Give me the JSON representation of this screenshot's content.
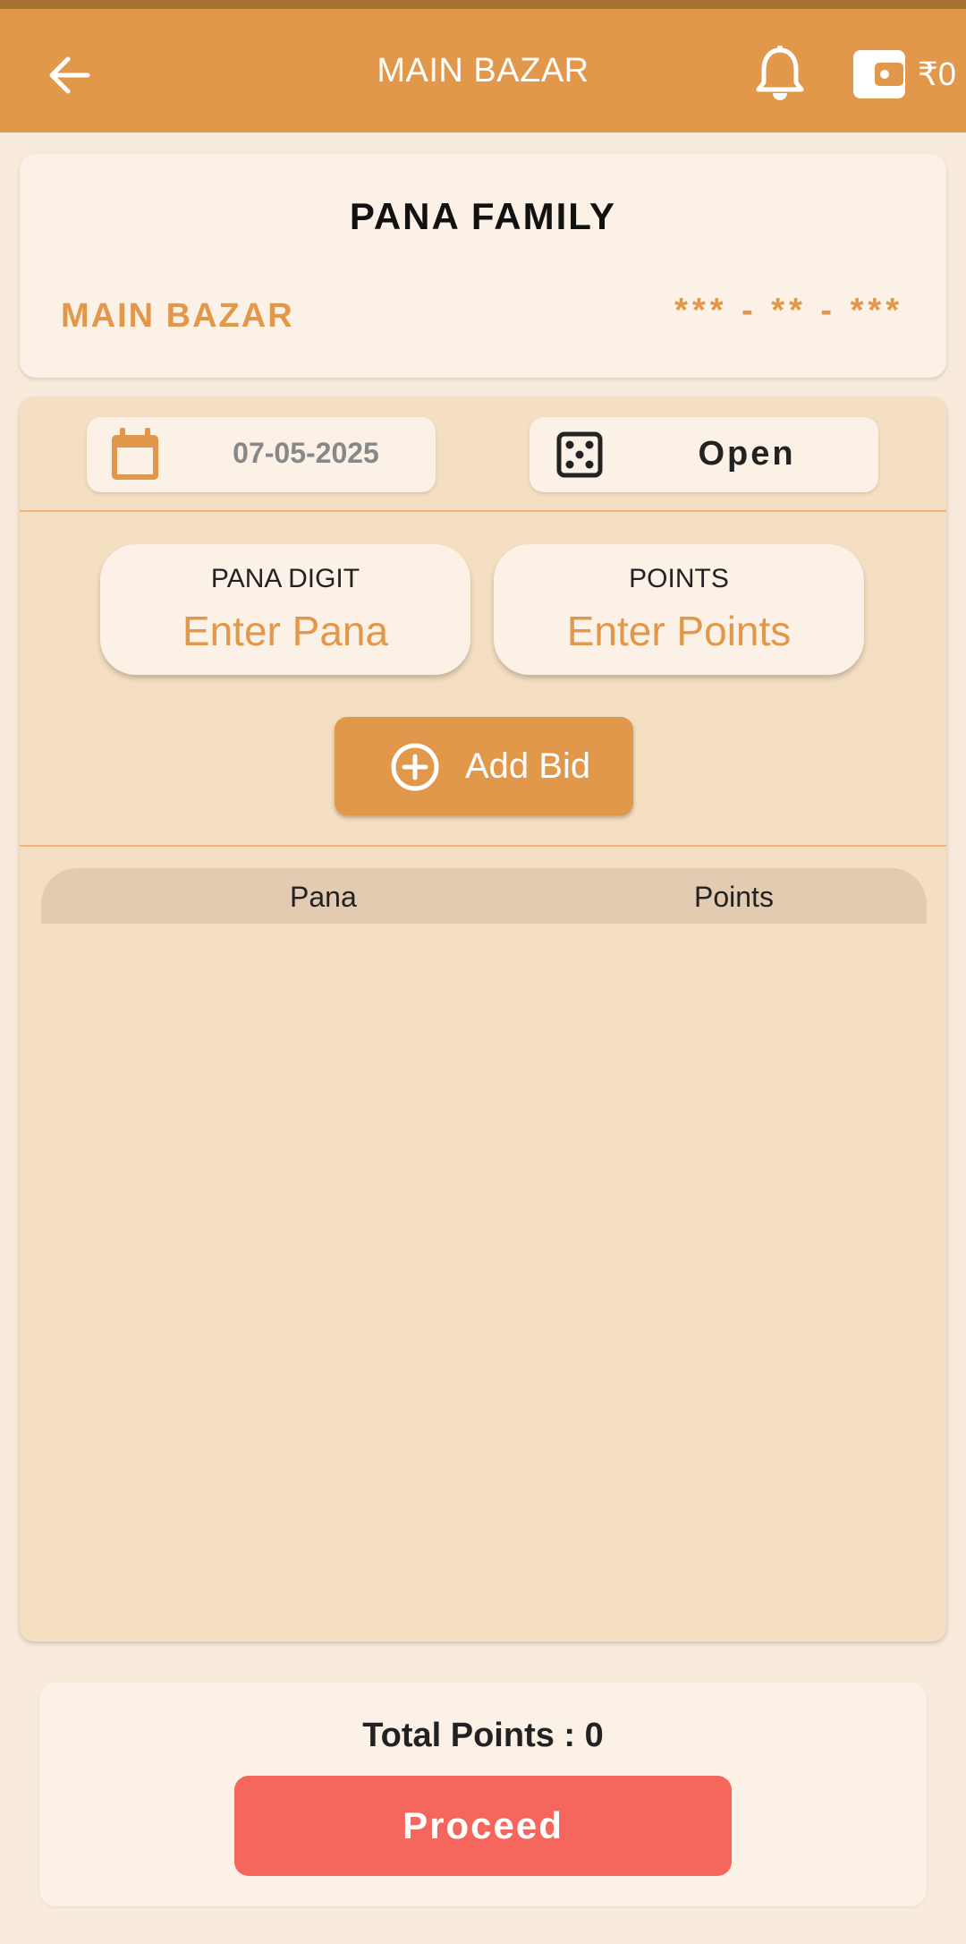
{
  "app_bar": {
    "title": "MAIN BAZAR",
    "wallet_balance": "₹0",
    "icons": [
      "back-arrow-icon",
      "bell-icon",
      "wallet-icon"
    ]
  },
  "game_card": {
    "title": "PANA FAMILY",
    "market_name": "MAIN BAZAR",
    "result": "*** - ** - ***"
  },
  "controls": {
    "date": "07-05-2025",
    "session": "Open",
    "icons": [
      "calendar-icon",
      "dice-icon"
    ]
  },
  "inputs": {
    "pana_label": "PANA DIGIT",
    "pana_placeholder": "Enter Pana",
    "points_label": "POINTS",
    "points_placeholder": "Enter Points"
  },
  "add_bid": {
    "label": "Add Bid",
    "icon": "plus-circle-icon"
  },
  "bids_table": {
    "columns": [
      "Pana",
      "Points"
    ],
    "rows": []
  },
  "footer": {
    "total_points": "Total Points : 0",
    "proceed_label": "Proceed"
  },
  "colors": {
    "primary": "#e2984a",
    "panel": "#f5dfc2",
    "card": "#fbf1e6",
    "proceed": "#f5665c"
  }
}
